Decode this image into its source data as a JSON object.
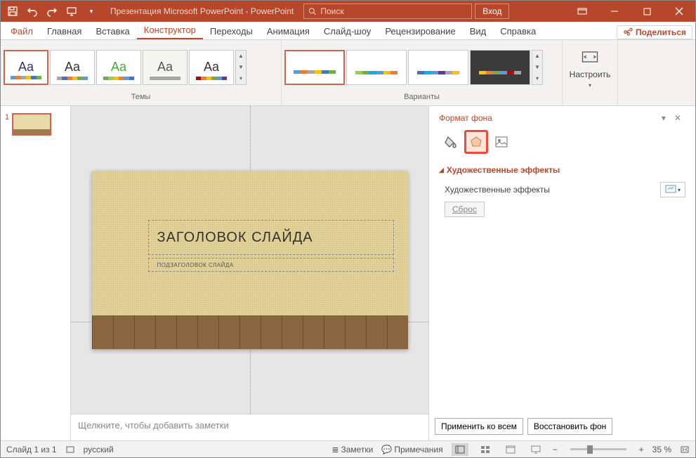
{
  "title": "Презентация Microsoft PowerPoint  -  PowerPoint",
  "search": {
    "placeholder": "Поиск"
  },
  "login": "Вход",
  "tabs": {
    "file": "Файл",
    "home": "Главная",
    "insert": "Вставка",
    "design": "Конструктор",
    "transitions": "Переходы",
    "animations": "Анимация",
    "slideshow": "Слайд-шоу",
    "review": "Рецензирование",
    "view": "Вид",
    "help": "Справка"
  },
  "share": "Поделиться",
  "groups": {
    "themes": "Темы",
    "variants": "Варианты",
    "configure": "Настроить"
  },
  "slide": {
    "title": "ЗАГОЛОВОК СЛАЙДА",
    "subtitle": "ПОДЗАГОЛОВОК СЛАЙДА"
  },
  "notes_placeholder": "Щелкните, чтобы добавить заметки",
  "pane": {
    "title": "Формат фона",
    "section": "Художественные эффекты",
    "effects_label": "Художественные эффекты",
    "reset": "Сброс",
    "apply_all": "Применить ко всем",
    "restore": "Восстановить фон"
  },
  "status": {
    "slide": "Слайд 1 из 1",
    "lang": "русский",
    "notes": "Заметки",
    "comments": "Примечания",
    "zoom": "35 %"
  },
  "thumb_num": "1",
  "icons": {
    "search": "search-icon",
    "fill": "paint-bucket-icon",
    "effects": "pentagon-icon",
    "picture": "picture-icon"
  }
}
